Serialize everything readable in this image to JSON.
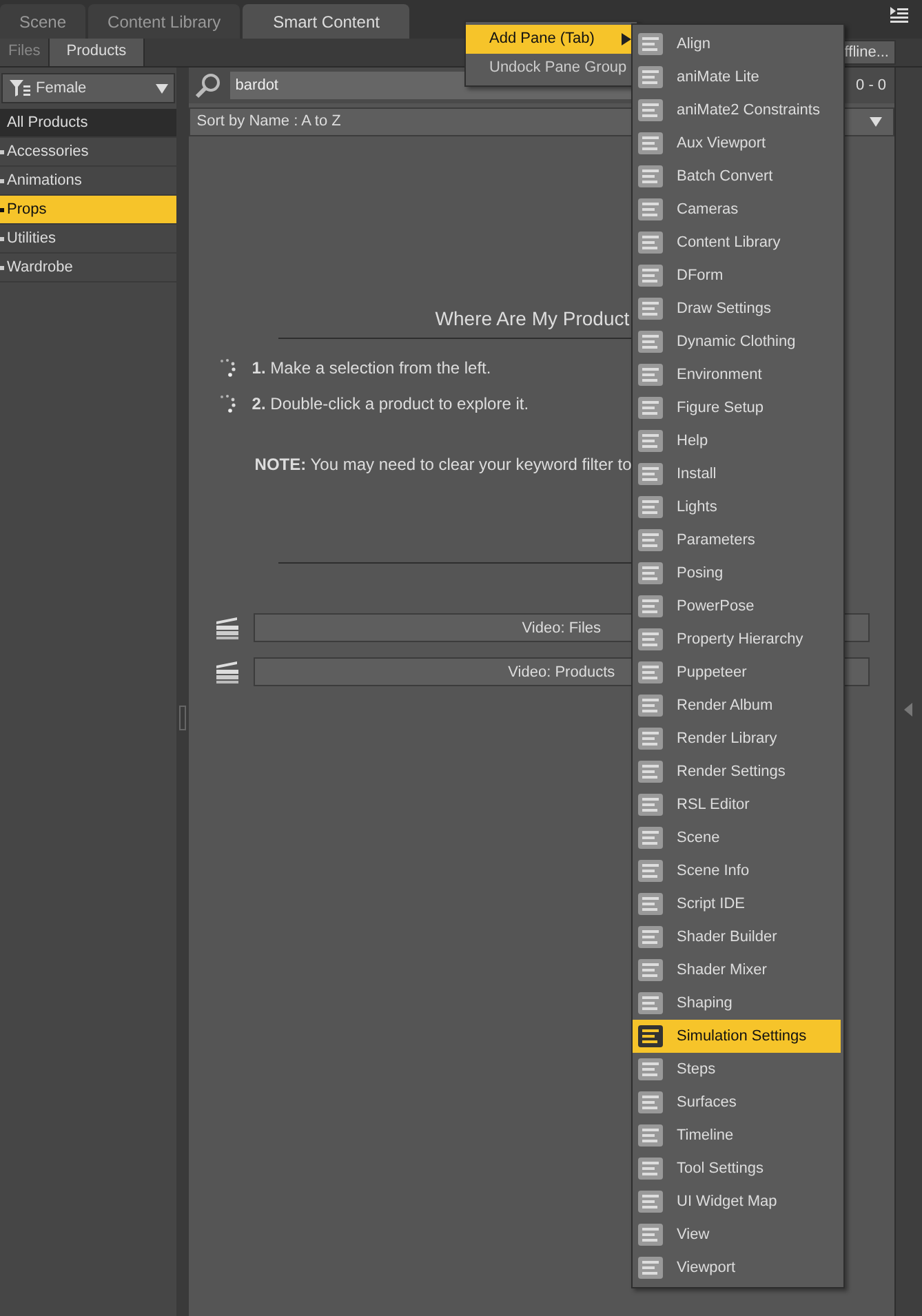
{
  "tabs": [
    {
      "label": "Scene",
      "selected": false
    },
    {
      "label": "Content Library",
      "selected": false
    },
    {
      "label": "Smart Content",
      "selected": true
    }
  ],
  "subtabs": [
    {
      "label": "Files",
      "selected": false
    },
    {
      "label": "Products",
      "selected": true
    }
  ],
  "offline_button": "ffline...",
  "filter": {
    "label": "Female"
  },
  "categories": [
    {
      "label": "All Products",
      "kind": "root",
      "selected": false
    },
    {
      "label": "Accessories",
      "kind": "category",
      "selected": false
    },
    {
      "label": "Animations",
      "kind": "category",
      "selected": false
    },
    {
      "label": "Props",
      "kind": "category",
      "selected": true
    },
    {
      "label": "Utilities",
      "kind": "category",
      "selected": false
    },
    {
      "label": "Wardrobe",
      "kind": "category",
      "selected": false
    }
  ],
  "search": {
    "value": "bardot"
  },
  "page_count": "0 - 0",
  "sort": {
    "value": "Sort by Name : A to Z"
  },
  "content": {
    "title": "Where Are My Product",
    "steps": [
      "**1.** Make a selection from the left.",
      "**2.** Double-click a product to explore it."
    ],
    "note": "**NOTE:** You may need to clear your keyword filter to"
  },
  "videos": [
    {
      "label": "Video: Files"
    },
    {
      "label": "Video: Products"
    }
  ],
  "context_menu": [
    {
      "label": "Add Pane (Tab)",
      "selected": true,
      "submenu": true
    },
    {
      "label": "Undock Pane Group",
      "selected": false,
      "submenu": false
    }
  ],
  "submenu": [
    {
      "label": "Align",
      "selected": false
    },
    {
      "label": "aniMate Lite",
      "selected": false
    },
    {
      "label": "aniMate2 Constraints",
      "selected": false
    },
    {
      "label": "Aux Viewport",
      "selected": false
    },
    {
      "label": "Batch Convert",
      "selected": false
    },
    {
      "label": "Cameras",
      "selected": false
    },
    {
      "label": "Content Library",
      "selected": false
    },
    {
      "label": "DForm",
      "selected": false
    },
    {
      "label": "Draw Settings",
      "selected": false
    },
    {
      "label": "Dynamic Clothing",
      "selected": false
    },
    {
      "label": "Environment",
      "selected": false
    },
    {
      "label": "Figure Setup",
      "selected": false
    },
    {
      "label": "Help",
      "selected": false
    },
    {
      "label": "Install",
      "selected": false
    },
    {
      "label": "Lights",
      "selected": false
    },
    {
      "label": "Parameters",
      "selected": false
    },
    {
      "label": "Posing",
      "selected": false
    },
    {
      "label": "PowerPose",
      "selected": false
    },
    {
      "label": "Property Hierarchy",
      "selected": false
    },
    {
      "label": "Puppeteer",
      "selected": false
    },
    {
      "label": "Render Album",
      "selected": false
    },
    {
      "label": "Render Library",
      "selected": false
    },
    {
      "label": "Render Settings",
      "selected": false
    },
    {
      "label": "RSL Editor",
      "selected": false
    },
    {
      "label": "Scene",
      "selected": false
    },
    {
      "label": "Scene Info",
      "selected": false
    },
    {
      "label": "Script IDE",
      "selected": false
    },
    {
      "label": "Shader Builder",
      "selected": false
    },
    {
      "label": "Shader Mixer",
      "selected": false
    },
    {
      "label": "Shaping",
      "selected": false
    },
    {
      "label": "Simulation Settings",
      "selected": true
    },
    {
      "label": "Steps",
      "selected": false
    },
    {
      "label": "Surfaces",
      "selected": false
    },
    {
      "label": "Timeline",
      "selected": false
    },
    {
      "label": "Tool Settings",
      "selected": false
    },
    {
      "label": "UI Widget Map",
      "selected": false
    },
    {
      "label": "View",
      "selected": false
    },
    {
      "label": "Viewport",
      "selected": false
    }
  ]
}
